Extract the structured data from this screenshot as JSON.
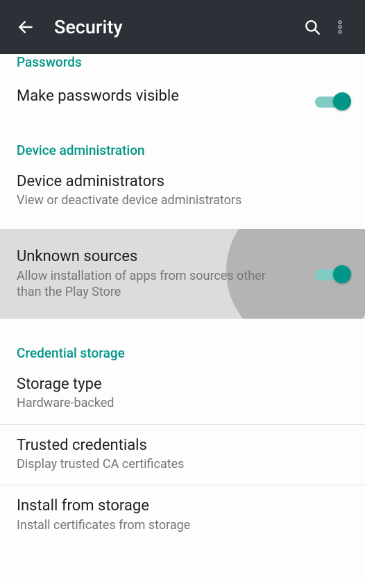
{
  "appbar": {
    "title": "Security"
  },
  "sections": {
    "passwords": {
      "header": "Passwords",
      "make_visible": {
        "title": "Make passwords visible",
        "on": true
      }
    },
    "device_admin": {
      "header": "Device administration",
      "administrators": {
        "title": "Device administrators",
        "subtitle": "View or deactivate device administrators"
      },
      "unknown_sources": {
        "title": "Unknown sources",
        "subtitle": "Allow installation of apps from sources other than the Play Store",
        "on": true
      }
    },
    "credential": {
      "header": "Credential storage",
      "storage_type": {
        "title": "Storage type",
        "subtitle": "Hardware-backed"
      },
      "trusted": {
        "title": "Trusted credentials",
        "subtitle": "Display trusted CA certificates"
      },
      "install": {
        "title": "Install from storage",
        "subtitle": "Install certificates from storage"
      }
    }
  }
}
